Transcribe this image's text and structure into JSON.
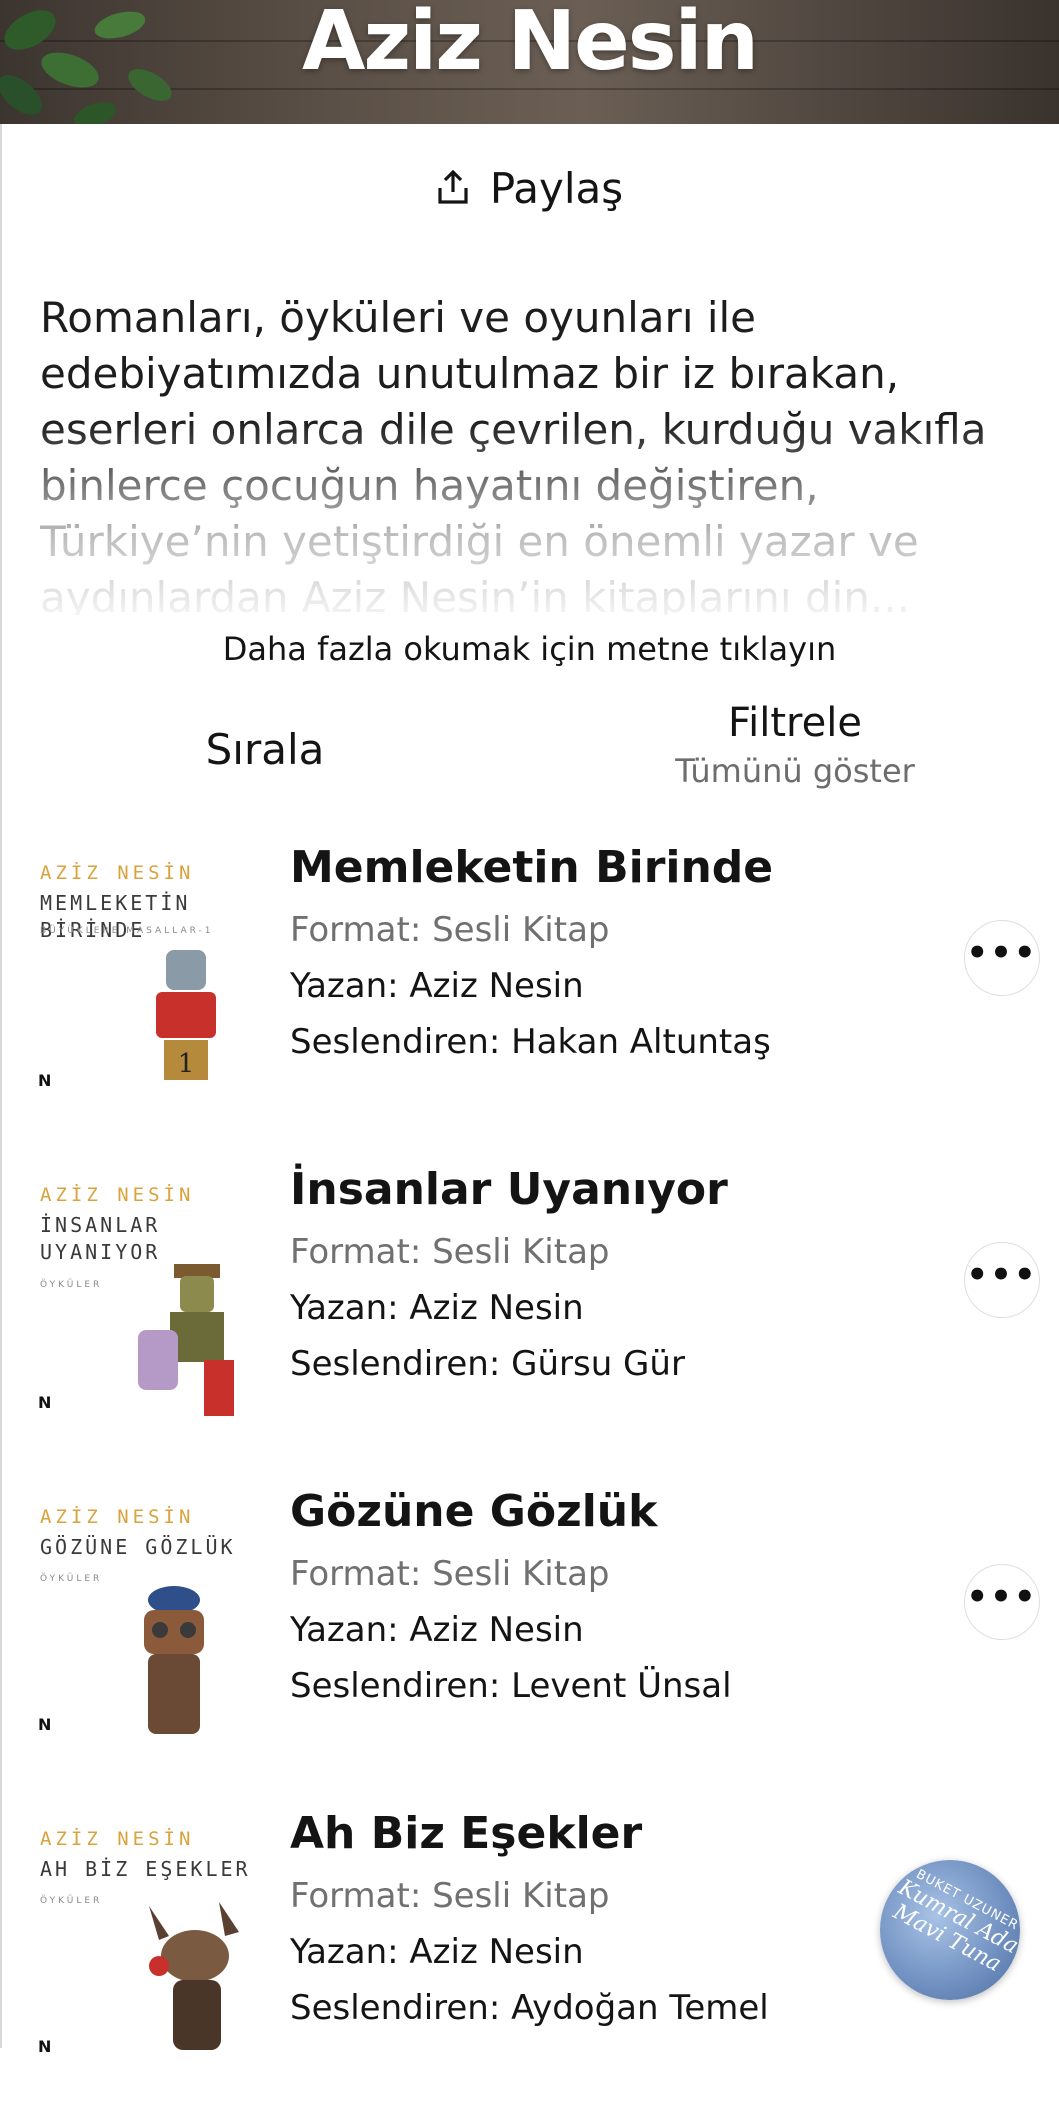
{
  "header": {
    "title": "Aziz Nesin"
  },
  "share": {
    "label": "Paylaş",
    "icon": "share-icon"
  },
  "description": {
    "text": "Romanları, öyküleri ve oyunları ile edebiyatımızda unutulmaz bir iz bırakan, eserleri onlarca dile çevrilen, kurduğu vakıfla binlerce çocuğun hayatını değiştiren, Türkiye’nin yetiştirdiği en önemli yazar ve aydınlardan Aziz Nesin’in kitaplarını din...",
    "read_more": "Daha fazla okumak için metne tıklayın"
  },
  "controls": {
    "sort_label": "Sırala",
    "filter_label": "Filtrele",
    "filter_value": "Tümünü göster"
  },
  "books": [
    {
      "title": "Memleketin Birinde",
      "format": "Format: Sesli Kitap",
      "author": "Yazan: Aziz Nesin",
      "narrator": "Seslendiren: Hakan Altuntaş",
      "cover": {
        "author": "AZİZ NESİN",
        "title": "MEMLEKETİN BİRİNDE",
        "subtitle": "BÜYÜKLERE MASALLAR-1",
        "logo": "N",
        "accent": "#c8302c"
      }
    },
    {
      "title": "İnsanlar Uyanıyor",
      "format": "Format: Sesli Kitap",
      "author": "Yazan: Aziz Nesin",
      "narrator": "Seslendiren: Gürsu Gür",
      "cover": {
        "author": "AZİZ NESİN",
        "title": "İNSANLAR UYANIYOR",
        "subtitle": "ÖYKÜLER",
        "logo": "N",
        "accent": "#7a5a2e"
      }
    },
    {
      "title": "Gözüne Gözlük",
      "format": "Format: Sesli Kitap",
      "author": "Yazan: Aziz Nesin",
      "narrator": "Seslendiren: Levent Ünsal",
      "cover": {
        "author": "AZİZ NESİN",
        "title": "GÖZÜNE GÖZLÜK",
        "subtitle": "ÖYKÜLER",
        "logo": "N",
        "accent": "#2f4f8a"
      }
    },
    {
      "title": "Ah Biz Eşekler",
      "format": "Format: Sesli Kitap",
      "author": "Yazan: Aziz Nesin",
      "narrator": "Seslendiren: Aydoğan Temel",
      "cover": {
        "author": "AZİZ NESİN",
        "title": "AH BİZ EŞEKLER",
        "subtitle": "ÖYKÜLER",
        "logo": "N",
        "accent": "#5a4030"
      }
    }
  ],
  "mini_player": {
    "author": "BUKET UZUNER",
    "title": "Kumral Ada Mavi Tuna"
  },
  "colors": {
    "text": "#141414",
    "muted": "#707070",
    "cover_author": "#d9a23c"
  }
}
